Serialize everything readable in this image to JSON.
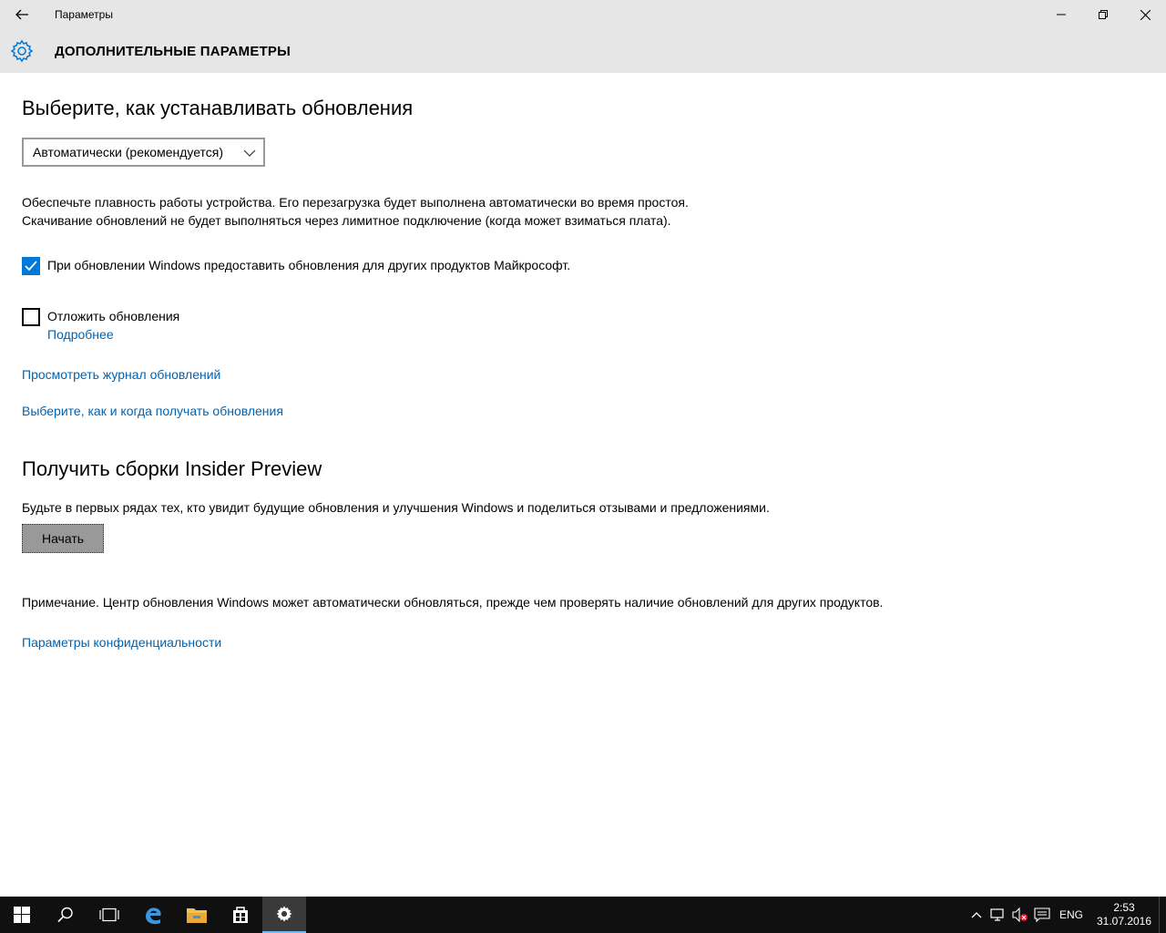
{
  "window": {
    "title": "Параметры",
    "page_title": "ДОПОЛНИТЕЛЬНЫЕ ПАРАМЕТРЫ"
  },
  "updates": {
    "heading": "Выберите, как устанавливать обновления",
    "mode_selected": "Автоматически (рекомендуется)",
    "desc_line1": "Обеспечьте плавность работы устройства. Его перезагрузка будет выполнена автоматически во время простоя.",
    "desc_line2": "Скачивание обновлений не будет выполняться через лимитное подключение (когда может взиматься плата).",
    "other_products_label": "При обновлении Windows предоставить обновления для других продуктов Майкрософт.",
    "other_products_checked": true,
    "defer_label": "Отложить обновления",
    "defer_checked": false,
    "defer_more_link": "Подробнее",
    "history_link": "Просмотреть журнал обновлений",
    "delivery_link": "Выберите, как и когда получать обновления"
  },
  "insider": {
    "heading": "Получить сборки Insider Preview",
    "desc": "Будьте в первых рядах тех, кто увидит будущие обновления и улучшения Windows и поделиться отзывами и предложениями.",
    "start_button": "Начать"
  },
  "note": "Примечание. Центр обновления Windows может автоматически обновляться, прежде чем проверять наличие обновлений для других продуктов.",
  "privacy_link": "Параметры конфиденциальности",
  "taskbar": {
    "language": "ENG",
    "time": "2:53",
    "date": "31.07.2016"
  },
  "colors": {
    "accent": "#0078d7",
    "link": "#0063b1",
    "titlebar": "#e6e6e6",
    "taskbar": "#101010"
  }
}
